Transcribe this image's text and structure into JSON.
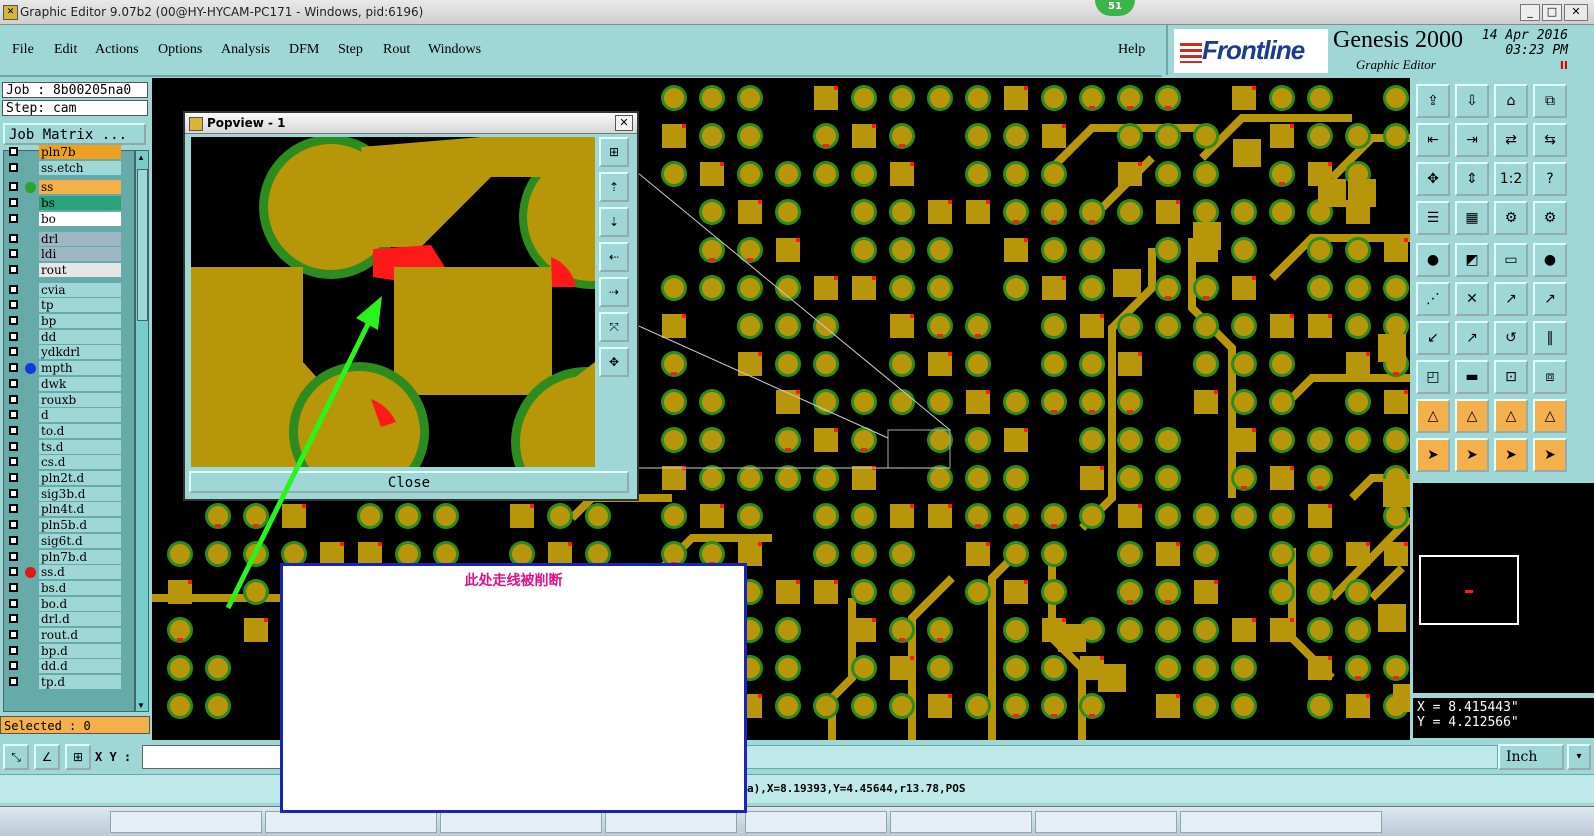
{
  "window": {
    "title": "Graphic Editor 9.07b2 (00@HY-HYCAM-PC171 - Windows, pid:6196)",
    "badge": "51"
  },
  "menu": [
    "File",
    "Edit",
    "Actions",
    "Options",
    "Analysis",
    "DFM",
    "Step",
    "Rout",
    "Windows"
  ],
  "help": "Help",
  "logo": {
    "brand": "Frontline",
    "product": "Genesis 2000",
    "sub": "Graphic Editor",
    "date": "14 Apr 2016",
    "time": "03:23 PM"
  },
  "job": {
    "job": "Job : 8b00205na0",
    "step": "Step: cam",
    "matrix_button": "Job Matrix ..."
  },
  "layers": [
    {
      "name": "pln7b",
      "bg": "#f0a020",
      "dot": ""
    },
    {
      "name": "ss.etch",
      "bg": "#9fd6d6",
      "dot": ""
    },
    {
      "name": "ss",
      "bg": "#f4b04a",
      "dot": "#2fa32f"
    },
    {
      "name": "bs",
      "bg": "#2ba27a",
      "dot": ""
    },
    {
      "name": "bo",
      "bg": "#ffffff",
      "dot": ""
    },
    {
      "name": "drl",
      "bg": "#9fb6c4",
      "dot": ""
    },
    {
      "name": "ldi",
      "bg": "#9fb6c4",
      "dot": ""
    },
    {
      "name": "rout",
      "bg": "#e6e6e6",
      "dot": ""
    },
    {
      "name": "cvia",
      "bg": "#9fd6d6",
      "dot": ""
    },
    {
      "name": "tp",
      "bg": "#9fd6d6",
      "dot": ""
    },
    {
      "name": "bp",
      "bg": "#9fd6d6",
      "dot": ""
    },
    {
      "name": "dd",
      "bg": "#9fd6d6",
      "dot": ""
    },
    {
      "name": "ydkdrl",
      "bg": "#9fd6d6",
      "dot": ""
    },
    {
      "name": "mpth",
      "bg": "#9fd6d6",
      "dot": "#1538d8"
    },
    {
      "name": "dwk",
      "bg": "#9fd6d6",
      "dot": ""
    },
    {
      "name": "rouxb",
      "bg": "#9fd6d6",
      "dot": ""
    },
    {
      "name": "d",
      "bg": "#9fd6d6",
      "dot": ""
    },
    {
      "name": "to.d",
      "bg": "#9fd6d6",
      "dot": ""
    },
    {
      "name": "ts.d",
      "bg": "#9fd6d6",
      "dot": ""
    },
    {
      "name": "cs.d",
      "bg": "#9fd6d6",
      "dot": ""
    },
    {
      "name": "pln2t.d",
      "bg": "#9fd6d6",
      "dot": ""
    },
    {
      "name": "sig3b.d",
      "bg": "#9fd6d6",
      "dot": ""
    },
    {
      "name": "pln4t.d",
      "bg": "#9fd6d6",
      "dot": ""
    },
    {
      "name": "pln5b.d",
      "bg": "#9fd6d6",
      "dot": ""
    },
    {
      "name": "sig6t.d",
      "bg": "#9fd6d6",
      "dot": ""
    },
    {
      "name": "pln7b.d",
      "bg": "#9fd6d6",
      "dot": ""
    },
    {
      "name": "ss.d",
      "bg": "#9fd6d6",
      "dot": "#e01818"
    },
    {
      "name": "bs.d",
      "bg": "#9fd6d6",
      "dot": ""
    },
    {
      "name": "bo.d",
      "bg": "#9fd6d6",
      "dot": ""
    },
    {
      "name": "drl.d",
      "bg": "#9fd6d6",
      "dot": ""
    },
    {
      "name": "rout.d",
      "bg": "#9fd6d6",
      "dot": ""
    },
    {
      "name": "bp.d",
      "bg": "#9fd6d6",
      "dot": ""
    },
    {
      "name": "dd.d",
      "bg": "#9fd6d6",
      "dot": ""
    },
    {
      "name": "tp.d",
      "bg": "#9fd6d6",
      "dot": ""
    }
  ],
  "selected": "Selected : 0",
  "popview": {
    "title": "Popview - 1",
    "close": "Close"
  },
  "note": "此处走线被削断",
  "coords": {
    "x": "X =  8.415443\"",
    "y": "Y =  4.212566\""
  },
  "xy_label": "X Y :",
  "units": "Inch",
  "status": "a),X=8.19393,Y=4.45644,r13.78,POS",
  "colors": {
    "copper": "#b8960a",
    "mask": "#2e8b1e",
    "error": "#ff1a1a",
    "panel": "#9fd6d6"
  }
}
